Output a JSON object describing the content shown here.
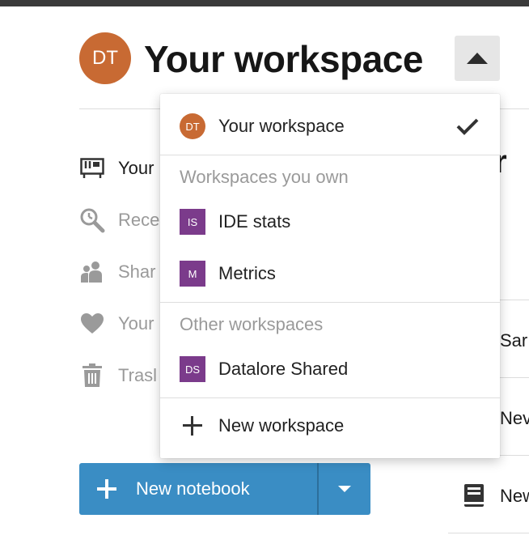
{
  "header": {
    "avatar_initials": "DT",
    "title": "Your workspace",
    "avatar_color": "#c86a33"
  },
  "sidebar": {
    "items": [
      {
        "label": "Your",
        "icon": "notebooks-icon"
      },
      {
        "label": "Rece",
        "icon": "recent-icon"
      },
      {
        "label": "Shar",
        "icon": "shared-icon"
      },
      {
        "label": "Your",
        "icon": "heart-icon"
      },
      {
        "label": "Trasl",
        "icon": "trash-icon"
      }
    ]
  },
  "new_notebook": {
    "label": "New notebook",
    "color": "#3a8dc4"
  },
  "right_panel": {
    "title": "ır",
    "rows": [
      "Sar",
      "Nev",
      "New"
    ]
  },
  "workspace_menu": {
    "current": {
      "initials": "DT",
      "label": "Your workspace",
      "selected": true
    },
    "owned_header": "Workspaces you own",
    "owned": [
      {
        "initials": "IS",
        "label": "IDE stats"
      },
      {
        "initials": "M",
        "label": "Metrics"
      }
    ],
    "other_header": "Other workspaces",
    "other": [
      {
        "initials": "DS",
        "label": "Datalore Shared"
      }
    ],
    "new_label": "New workspace",
    "badge_color": "#7b3b8b"
  }
}
